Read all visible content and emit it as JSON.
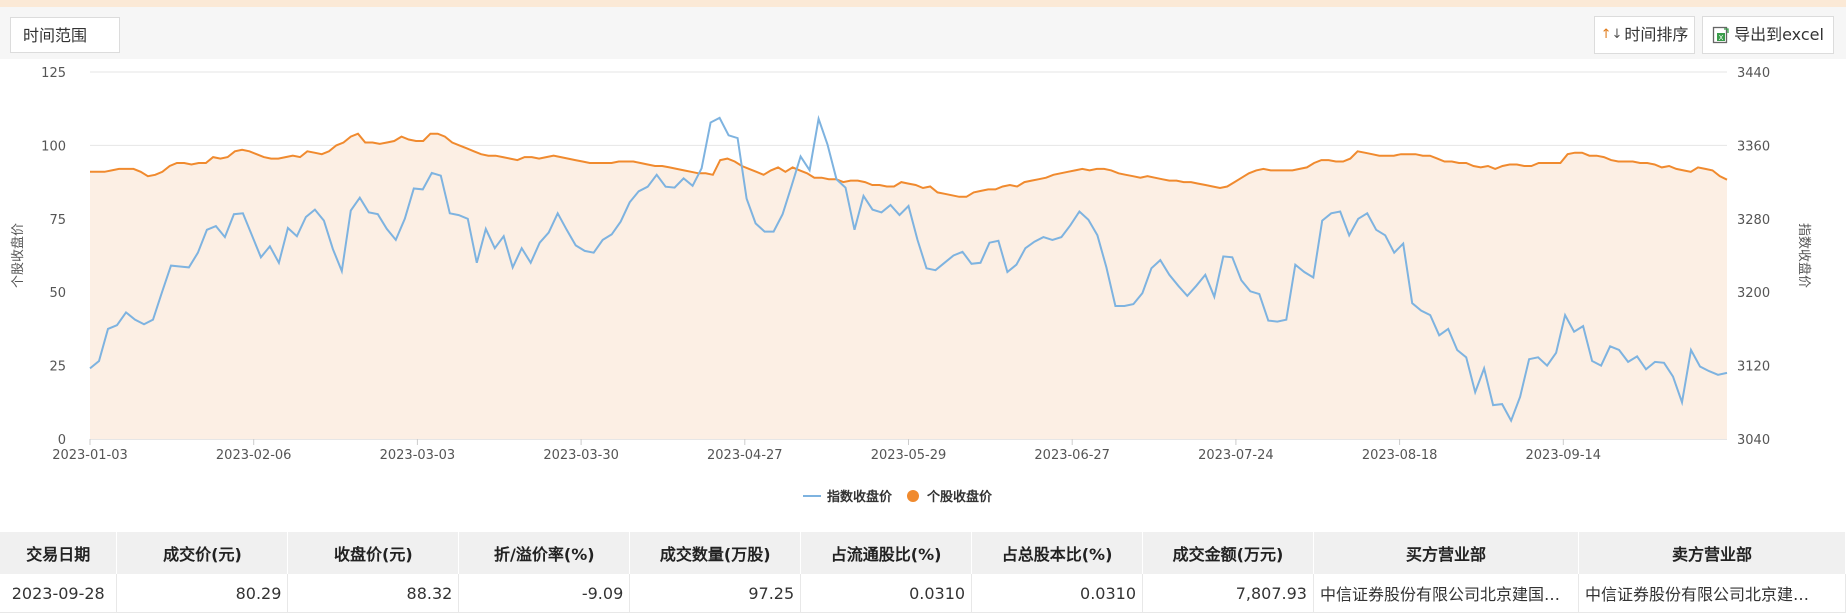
{
  "toolbar": {
    "time_range_label": "时间范围",
    "sort_label": "时间排序",
    "export_label": "导出到excel"
  },
  "chart_data": {
    "type": "line",
    "x_ticks": [
      "2023-01-03",
      "2023-02-06",
      "2023-03-03",
      "2023-03-30",
      "2023-04-27",
      "2023-05-29",
      "2023-06-27",
      "2023-07-24",
      "2023-08-18",
      "2023-09-14"
    ],
    "y_left": {
      "label": "个股收盘价",
      "ticks": [
        0,
        25,
        50,
        75,
        100,
        125
      ],
      "range": [
        0,
        125
      ]
    },
    "y_right": {
      "label": "指数收盘价",
      "ticks": [
        3040,
        3120,
        3200,
        3280,
        3360,
        3440
      ],
      "range": [
        3040,
        3440
      ]
    },
    "series": [
      {
        "name": "指数收盘价",
        "axis": "right",
        "color": "#7eb3e0",
        "values": [
          3117,
          3125,
          3160,
          3164,
          3178,
          3170,
          3165,
          3170,
          3200,
          3229,
          3228,
          3227,
          3243,
          3268,
          3272,
          3260,
          3285,
          3286,
          3262,
          3238,
          3250,
          3232,
          3270,
          3261,
          3282,
          3290,
          3278,
          3247,
          3223,
          3289,
          3303,
          3287,
          3285,
          3269,
          3257,
          3280,
          3313,
          3312,
          3330,
          3327,
          3286,
          3284,
          3280,
          3232,
          3269,
          3248,
          3261,
          3227,
          3248,
          3232,
          3254,
          3265,
          3286,
          3268,
          3251,
          3245,
          3243,
          3257,
          3263,
          3277,
          3298,
          3310,
          3315,
          3328,
          3315,
          3314,
          3324,
          3316,
          3335,
          3385,
          3390,
          3371,
          3368,
          3302,
          3275,
          3266,
          3266,
          3285,
          3316,
          3348,
          3333,
          3389,
          3361,
          3323,
          3314,
          3268,
          3305,
          3290,
          3287,
          3295,
          3284,
          3294,
          3257,
          3226,
          3224,
          3232,
          3240,
          3244,
          3231,
          3232,
          3254,
          3256,
          3222,
          3230,
          3248,
          3255,
          3260,
          3257,
          3260,
          3273,
          3288,
          3279,
          3262,
          3227,
          3185,
          3185,
          3187,
          3199,
          3226,
          3235,
          3219,
          3207,
          3196,
          3207,
          3219,
          3195,
          3239,
          3238,
          3213,
          3201,
          3198,
          3169,
          3168,
          3170,
          3230,
          3222,
          3216,
          3278,
          3286,
          3288,
          3262,
          3280,
          3286,
          3268,
          3262,
          3243,
          3253,
          3188,
          3180,
          3175,
          3153,
          3160,
          3137,
          3129,
          3091,
          3117,
          3077,
          3078,
          3060,
          3086,
          3127,
          3129,
          3120,
          3134,
          3175,
          3157,
          3163,
          3125,
          3120,
          3141,
          3137,
          3124,
          3130,
          3116,
          3124,
          3123,
          3108,
          3080,
          3137,
          3119,
          3114,
          3110,
          3112
        ]
      },
      {
        "name": "个股收盘价",
        "axis": "left",
        "color": "#f08a2e",
        "values": [
          91,
          91,
          91,
          91.5,
          92,
          92,
          92,
          91,
          89.5,
          90,
          91,
          93,
          94,
          94,
          93.5,
          94,
          94,
          96,
          95.5,
          96,
          98,
          98.5,
          98,
          97,
          96,
          95.5,
          95.5,
          96,
          96.5,
          96,
          98,
          97.5,
          97,
          98,
          100,
          101,
          103,
          104,
          101,
          101,
          100.5,
          101,
          101.5,
          103,
          102,
          101.5,
          101.5,
          104,
          104,
          103,
          101,
          100,
          99,
          98,
          97,
          96.5,
          96.5,
          96,
          95.5,
          95,
          96,
          96,
          95.5,
          96,
          96.5,
          96,
          95.5,
          95,
          94.5,
          94,
          94,
          94,
          94,
          94.5,
          94.5,
          94.5,
          94,
          93.5,
          93,
          93,
          92.5,
          92,
          91.5,
          91,
          90.5,
          90.5,
          90,
          95,
          95.5,
          94.5,
          93,
          92,
          91,
          90,
          91.5,
          92.5,
          91,
          92.5,
          91.5,
          90.5,
          89,
          89,
          88.5,
          88.5,
          87.5,
          88,
          88,
          87.5,
          86.5,
          86.5,
          86,
          86,
          87.5,
          87,
          86.5,
          85.5,
          86,
          84,
          83.5,
          83,
          82.5,
          82.5,
          84,
          84.5,
          85,
          85,
          86,
          86.5,
          86,
          87.5,
          88,
          88.5,
          89,
          90,
          90.5,
          91,
          91.5,
          92,
          91.5,
          92,
          92,
          91.5,
          90.5,
          90,
          89.5,
          89,
          89.5,
          89,
          88.5,
          88,
          88,
          87.5,
          87.5,
          87,
          86.5,
          86,
          85.5,
          86,
          87.5,
          89,
          90.5,
          91.5,
          92,
          91.5,
          91.5,
          91.5,
          91.5,
          92,
          92.5,
          94,
          95,
          95,
          94.5,
          94.5,
          95.5,
          98,
          97.5,
          97,
          96.5,
          96.5,
          96.5,
          97,
          97,
          97,
          96.5,
          96.5,
          95.5,
          94.5,
          94.5,
          94,
          94,
          93,
          92.5,
          93,
          92,
          93,
          93.5,
          93.5,
          93,
          93,
          94,
          94,
          94,
          94,
          97,
          97.5,
          97.5,
          96.5,
          96.5,
          96,
          95,
          94.5,
          94.5,
          94.5,
          94,
          94,
          93.5,
          92.5,
          93,
          92,
          91.5,
          91,
          92.5,
          92,
          91.5,
          89.5,
          88.32
        ]
      }
    ],
    "legend": {
      "position": "bottom-center"
    }
  },
  "table": {
    "headers": [
      "交易日期",
      "成交价(元)",
      "收盘价(元)",
      "折/溢价率(%)",
      "成交数量(万股)",
      "占流通股比(%)",
      "占总股本比(%)",
      "成交金额(万元)",
      "买方营业部",
      "卖方营业部"
    ],
    "rows": [
      [
        "2023-09-28",
        "80.29",
        "88.32",
        "-9.09",
        "97.25",
        "0.0310",
        "0.0310",
        "7,807.93",
        "中信证券股份有限公司北京建国…",
        "中信证券股份有限公司北京建…"
      ]
    ]
  }
}
